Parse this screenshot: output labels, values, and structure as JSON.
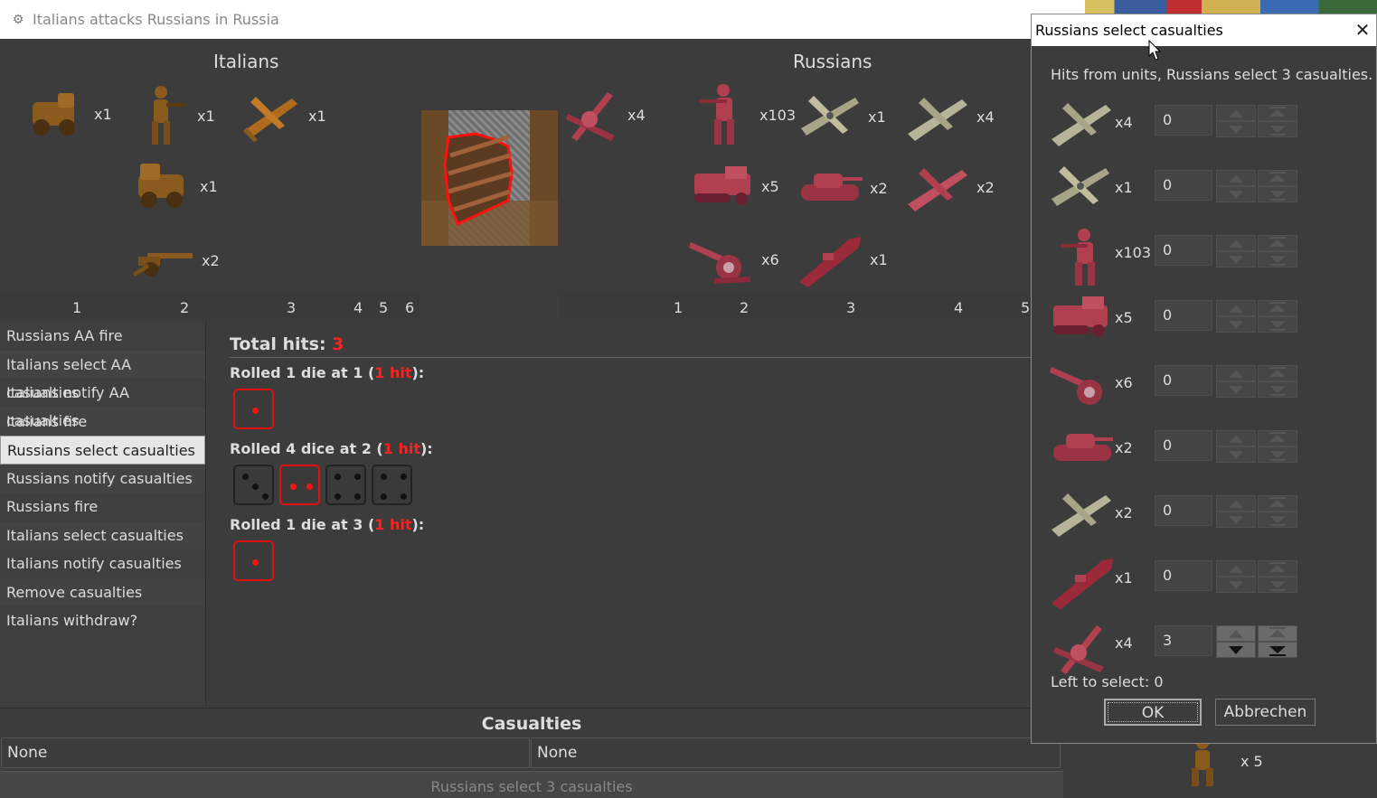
{
  "window": {
    "title": "Italians attacks Russians in Russia"
  },
  "battle": {
    "attacker_name": "Italians",
    "defender_name": "Russians",
    "attacker_units": [
      {
        "icon": "armored-car-icon",
        "count": "x1"
      },
      {
        "icon": "infantry-icon",
        "count": "x1"
      },
      {
        "icon": "fighter-plane-icon",
        "count": "x1"
      },
      {
        "icon": "armored-car-icon",
        "count": "x1"
      },
      {
        "icon": "artillery-icon",
        "count": "x2"
      }
    ],
    "defender_units": [
      {
        "icon": "aa-gun-icon",
        "count": "x4"
      },
      {
        "icon": "infantry-icon",
        "count": "x103"
      },
      {
        "icon": "bomber-plane-icon",
        "count": "x1"
      },
      {
        "icon": "fighter-plane-icon",
        "count": "x4"
      },
      {
        "icon": "halftrack-icon",
        "count": "x5"
      },
      {
        "icon": "tank-icon",
        "count": "x2"
      },
      {
        "icon": "fighter-plane-icon",
        "count": "x2"
      },
      {
        "icon": "artillery-icon",
        "count": "x6"
      },
      {
        "icon": "submarine-icon",
        "count": "x1"
      }
    ],
    "attacker_axis": [
      "1",
      "2",
      "3",
      "4",
      "5",
      "6"
    ],
    "defender_axis": [
      "1",
      "2",
      "3",
      "4",
      "5"
    ]
  },
  "steps": [
    {
      "label": "Russians AA fire",
      "active": false
    },
    {
      "label": "Italians select AA casualties",
      "active": false
    },
    {
      "label": "Italians notify AA casualties",
      "active": false
    },
    {
      "label": "Italians fire",
      "active": false
    },
    {
      "label": "Russians select casualties",
      "active": true
    },
    {
      "label": "Russians notify casualties",
      "active": false
    },
    {
      "label": "Russians fire",
      "active": false
    },
    {
      "label": "Italians select casualties",
      "active": false
    },
    {
      "label": "Italians notify casualties",
      "active": false
    },
    {
      "label": "Remove casualties",
      "active": false
    },
    {
      "label": "Italians withdraw?",
      "active": false
    }
  ],
  "results": {
    "total_label": "Total hits: ",
    "total_value": "3",
    "rolls": [
      {
        "prefix": "Rolled 1 die at 1 (",
        "hits": "1 hit",
        "suffix": "):",
        "dice": [
          {
            "value": 1,
            "hit": true
          }
        ]
      },
      {
        "prefix": "Rolled 4 dice at 2 (",
        "hits": "1 hit",
        "suffix": "):",
        "dice": [
          {
            "value": 3,
            "hit": false
          },
          {
            "value": 2,
            "hit": true
          },
          {
            "value": 4,
            "hit": false
          },
          {
            "value": 4,
            "hit": false
          }
        ]
      },
      {
        "prefix": "Rolled 1 die at 3 (",
        "hits": "1 hit",
        "suffix": "):",
        "dice": [
          {
            "value": 1,
            "hit": true
          }
        ]
      }
    ]
  },
  "casualties": {
    "title": "Casualties",
    "attacker": "None",
    "defender": "None",
    "status": "Russians select 3 casualties"
  },
  "background": {
    "unit_count": "x 5"
  },
  "dialog": {
    "title": "Russians select casualties",
    "message": "Hits from units,  Russians select 3 casualties.",
    "rows": [
      {
        "icon": "fighter-plane-icon",
        "count": "x4",
        "value": "0"
      },
      {
        "icon": "bomber-plane-icon",
        "count": "x1",
        "value": "0"
      },
      {
        "icon": "infantry-icon",
        "count": "x103",
        "value": "0"
      },
      {
        "icon": "halftrack-icon",
        "count": "x5",
        "value": "0"
      },
      {
        "icon": "artillery-icon",
        "count": "x6",
        "value": "0"
      },
      {
        "icon": "tank-icon",
        "count": "x2",
        "value": "0"
      },
      {
        "icon": "fighter-plane-icon",
        "count": "x2",
        "value": "0"
      },
      {
        "icon": "submarine-icon",
        "count": "x1",
        "value": "0"
      },
      {
        "icon": "aa-gun-icon",
        "count": "x4",
        "value": "3"
      }
    ],
    "left_to_select": "Left to select: 0",
    "ok_label": "OK",
    "cancel_label": "Abbrechen"
  },
  "colors": {
    "italian_unit": "#8a5a1e",
    "russian_unit": "#b04050",
    "hit_red": "#ff2020"
  }
}
